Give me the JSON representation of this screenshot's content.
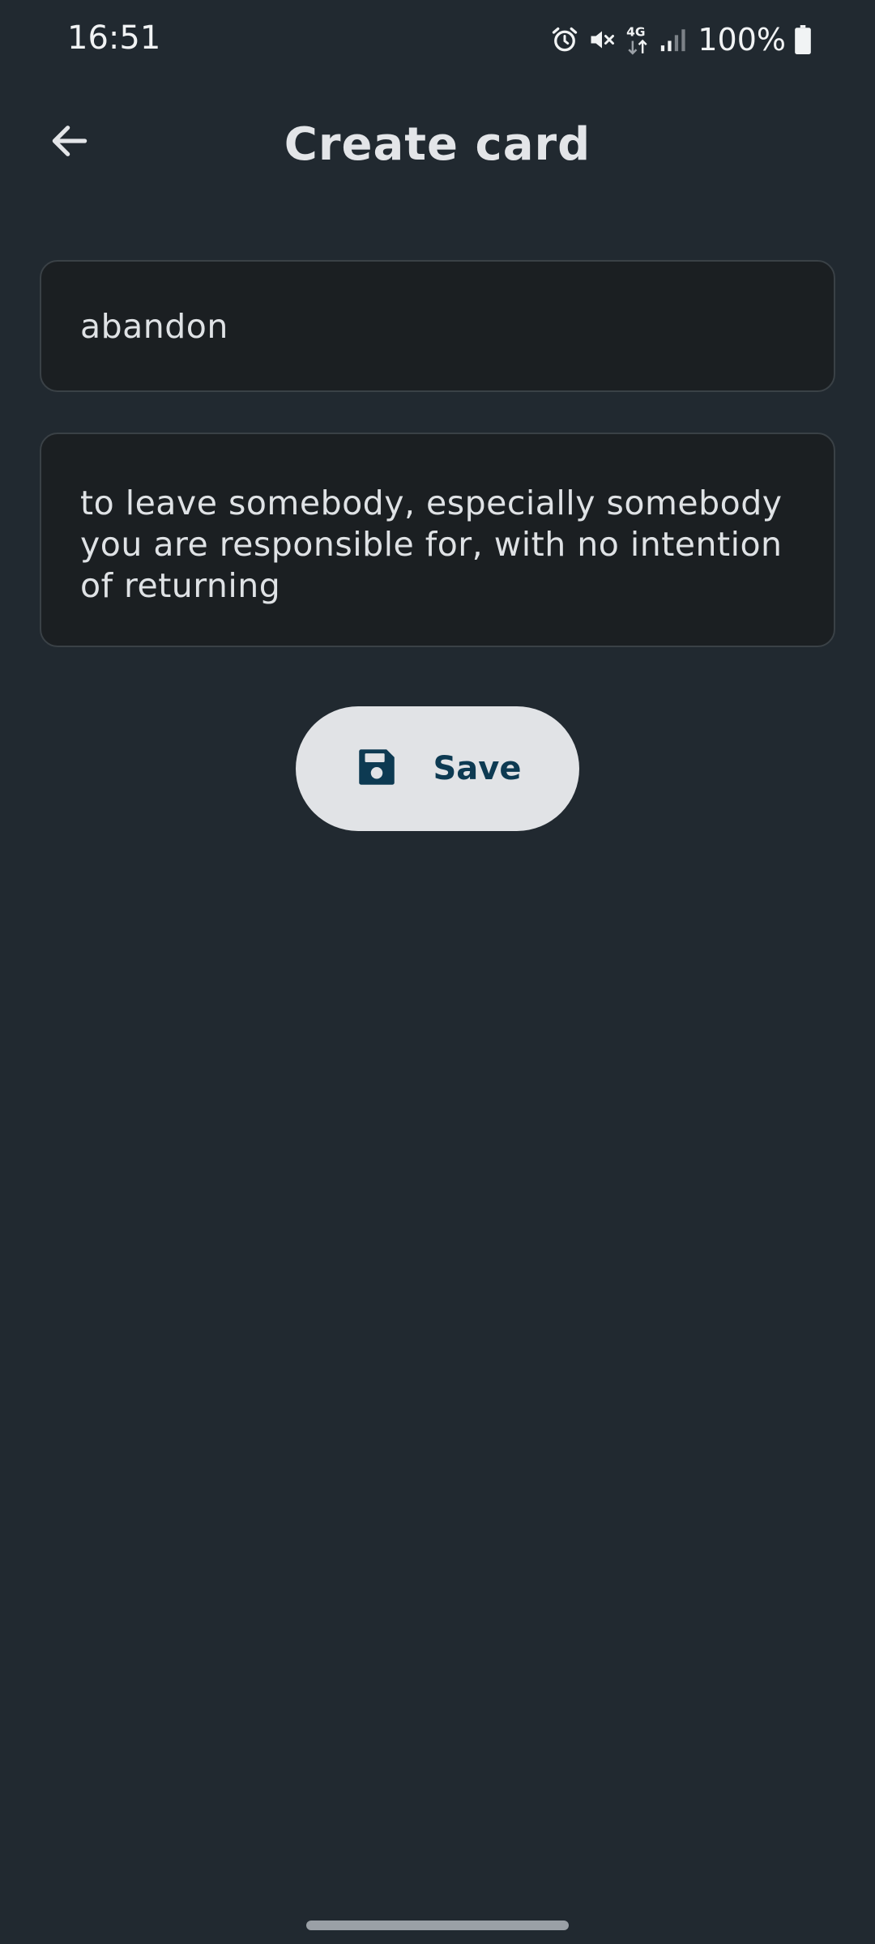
{
  "status_bar": {
    "time": "16:51",
    "battery": "100%",
    "icons": [
      "alarm-icon",
      "mute-icon",
      "network-4g-icon",
      "signal-icon",
      "battery-icon"
    ]
  },
  "header": {
    "title": "Create card",
    "back_icon": "arrow-left-icon"
  },
  "form": {
    "front_value": "abandon",
    "back_value": "to leave somebody, especially somebody you are responsible for, with no intention of returning"
  },
  "actions": {
    "save_label": "Save",
    "save_icon": "floppy-disk-icon"
  },
  "colors": {
    "background": "#212930",
    "field_background": "#1b1f22",
    "button_background": "#e1e3e6",
    "button_text": "#0d3a52"
  }
}
